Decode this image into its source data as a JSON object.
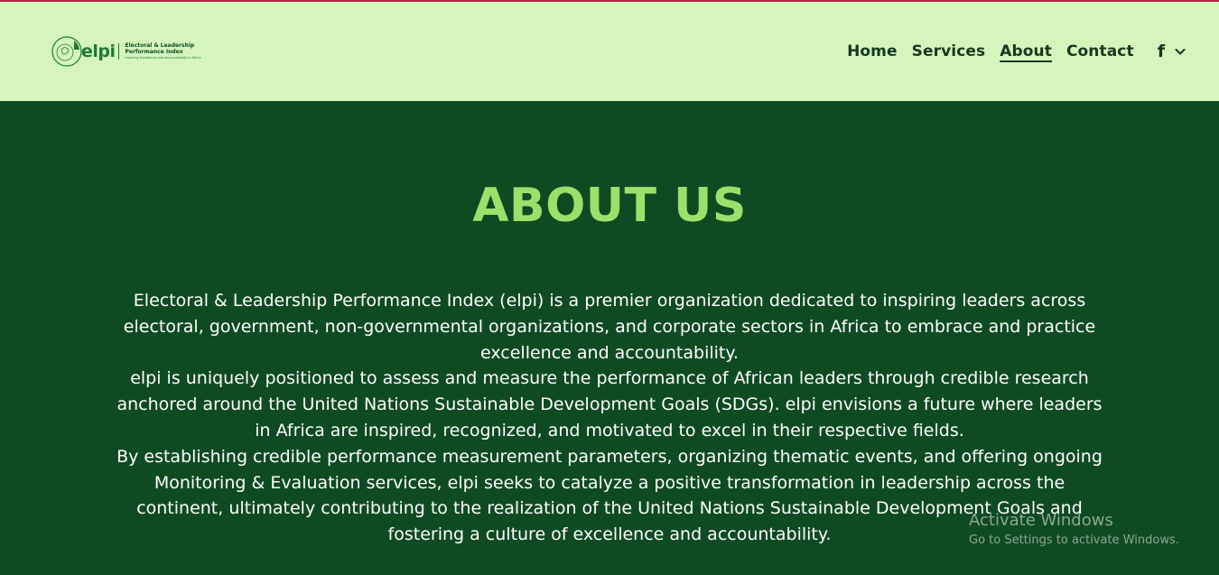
{
  "brand": {
    "wordmark": "elpi",
    "name_line1": "Electoral & Leadership",
    "name_line2": "Performance Index",
    "tagline": "Inspiring Excellence and Accountability in Africa"
  },
  "nav": {
    "items": [
      {
        "label": "Home"
      },
      {
        "label": "Services"
      },
      {
        "label": "About",
        "active": true
      },
      {
        "label": "Contact"
      }
    ],
    "social_icon": "facebook-icon",
    "dropdown_icon": "chevron-down-icon"
  },
  "about": {
    "title": "ABOUT US",
    "paragraphs": [
      "Electoral & Leadership Performance Index (elpi) is a premier organization dedicated to inspiring leaders across electoral, government, non-governmental organizations, and corporate sectors in Africa to embrace and practice excellence and accountability.",
      "elpi is uniquely positioned to assess and measure the performance of African leaders through credible research anchored around the United Nations Sustainable Development Goals (SDGs). elpi envisions a future where leaders in Africa are inspired, recognized, and motivated to excel in their respective fields.",
      "By establishing credible performance measurement parameters, organizing thematic events, and offering ongoing Monitoring & Evaluation services, elpi seeks to catalyze a positive transformation in leadership across the continent, ultimately contributing to the realization of the United Nations Sustainable Development Goals and fostering a culture of excellence and accountability."
    ]
  },
  "watermark": {
    "title": "Activate Windows",
    "subtitle": "Go to Settings to activate Windows."
  },
  "colors": {
    "header_bg": "#d6f5bd",
    "page_bg": "#0f4b22",
    "title": "#9be06a",
    "top_accent": "#b3244a"
  }
}
